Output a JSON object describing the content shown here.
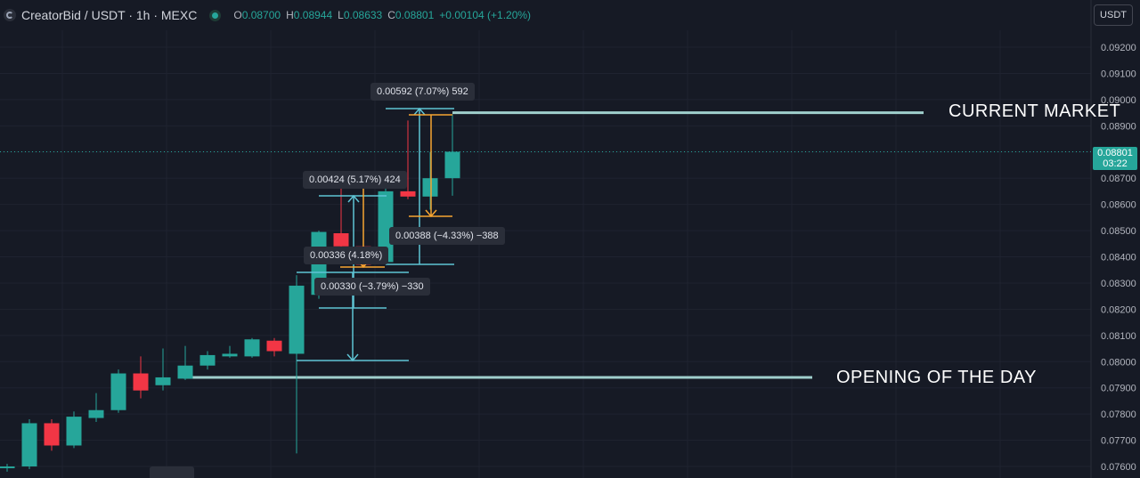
{
  "header": {
    "title": "CreatorBid / USDT · 1h · MEXC",
    "ohlc": {
      "o_label": "O",
      "o_value": "0.08700",
      "h_label": "H",
      "h_value": "0.08944",
      "l_label": "L",
      "l_value": "0.08633",
      "c_label": "C",
      "c_value": "0.08801",
      "change": "+0.00104 (+1.20%)"
    }
  },
  "currency_button": "USDT",
  "price_tag": {
    "price": "0.08801",
    "countdown": "03:22"
  },
  "colors": {
    "up": "#26a69a",
    "down": "#f23645",
    "measure": "#5fc4d4",
    "measure_alt": "#f7a531",
    "level": "#9fcfcc"
  },
  "annotations": {
    "current_market": "CURRENT MARKET",
    "opening": "OPENING OF THE DAY"
  },
  "measure_labels": {
    "m1": "0.00592 (7.07%) 592",
    "m2": "0.00424 (5.17%) 424",
    "m3": "0.00388 (−4.33%) −388",
    "m4": "0.00336 (4.18%)",
    "m5": "0.00330 (−3.79%) −330"
  },
  "chart_data": {
    "type": "candlestick",
    "y_ticks": [
      "0.09200",
      "0.09100",
      "0.09000",
      "0.08900",
      "0.08800",
      "0.08700",
      "0.08600",
      "0.08500",
      "0.08400",
      "0.08300",
      "0.08200",
      "0.08100",
      "0.08000",
      "0.07900",
      "0.07800",
      "0.07700",
      "0.07600"
    ],
    "ylim": [
      0.0756,
      0.0935
    ],
    "candles": [
      {
        "o": 0.07595,
        "h": 0.0761,
        "l": 0.0758,
        "c": 0.076
      },
      {
        "o": 0.076,
        "h": 0.0778,
        "l": 0.0759,
        "c": 0.07765
      },
      {
        "o": 0.07765,
        "h": 0.0778,
        "l": 0.0766,
        "c": 0.0768
      },
      {
        "o": 0.0768,
        "h": 0.0781,
        "l": 0.0767,
        "c": 0.0779
      },
      {
        "o": 0.07785,
        "h": 0.0788,
        "l": 0.0777,
        "c": 0.07815
      },
      {
        "o": 0.07815,
        "h": 0.0797,
        "l": 0.07805,
        "c": 0.07955
      },
      {
        "o": 0.07955,
        "h": 0.0802,
        "l": 0.0786,
        "c": 0.0789
      },
      {
        "o": 0.0791,
        "h": 0.0805,
        "l": 0.0789,
        "c": 0.0794
      },
      {
        "o": 0.07935,
        "h": 0.0806,
        "l": 0.0793,
        "c": 0.07985
      },
      {
        "o": 0.07985,
        "h": 0.0804,
        "l": 0.0797,
        "c": 0.08025
      },
      {
        "o": 0.0802,
        "h": 0.0806,
        "l": 0.08015,
        "c": 0.0803
      },
      {
        "o": 0.0802,
        "h": 0.0809,
        "l": 0.08015,
        "c": 0.08085
      },
      {
        "o": 0.0808,
        "h": 0.0809,
        "l": 0.0802,
        "c": 0.0804
      },
      {
        "o": 0.0803,
        "h": 0.0833,
        "l": 0.0765,
        "c": 0.0829
      },
      {
        "o": 0.08255,
        "h": 0.085,
        "l": 0.0824,
        "c": 0.08495
      },
      {
        "o": 0.0849,
        "h": 0.0867,
        "l": 0.0842,
        "c": 0.0844
      },
      {
        "o": 0.0844,
        "h": 0.0855,
        "l": 0.0838,
        "c": 0.0837
      },
      {
        "o": 0.0838,
        "h": 0.0866,
        "l": 0.0837,
        "c": 0.0865
      },
      {
        "o": 0.0865,
        "h": 0.0892,
        "l": 0.0862,
        "c": 0.0863
      },
      {
        "o": 0.0863,
        "h": 0.088,
        "l": 0.0858,
        "c": 0.087
      },
      {
        "o": 0.087,
        "h": 0.08944,
        "l": 0.08633,
        "c": 0.08801
      }
    ],
    "levels": [
      {
        "name": "current_market",
        "price": 0.0895
      },
      {
        "name": "opening",
        "price": 0.0794
      }
    ]
  }
}
